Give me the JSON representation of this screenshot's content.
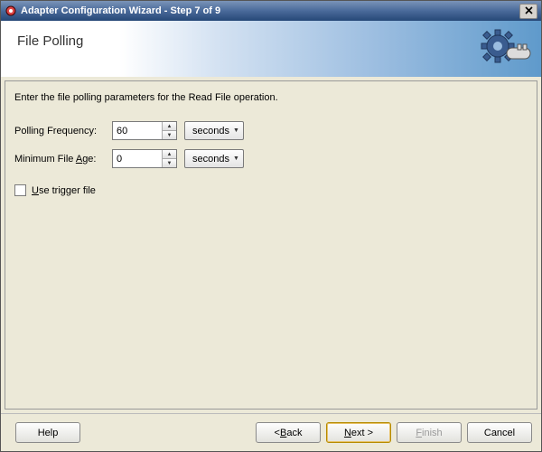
{
  "window": {
    "title": "Adapter Configuration Wizard - Step 7 of 9"
  },
  "header": {
    "page_title": "File Polling"
  },
  "content": {
    "instruction": "Enter the file polling parameters for the Read File operation.",
    "polling_frequency": {
      "label": "Polling Frequency:",
      "value": "60",
      "unit": "seconds"
    },
    "minimum_file_age": {
      "label_pre": "Minimum File ",
      "label_mnemonic": "A",
      "label_post": "ge:",
      "value": "0",
      "unit": "seconds"
    },
    "trigger": {
      "label_mnemonic": "U",
      "label_post": "se trigger file",
      "checked": false
    }
  },
  "footer": {
    "help": "Help",
    "back_pre": "< ",
    "back_mnemonic": "B",
    "back_post": "ack",
    "next_mnemonic": "N",
    "next_post": "ext >",
    "finish_mnemonic": "F",
    "finish_post": "inish",
    "cancel": "Cancel"
  }
}
